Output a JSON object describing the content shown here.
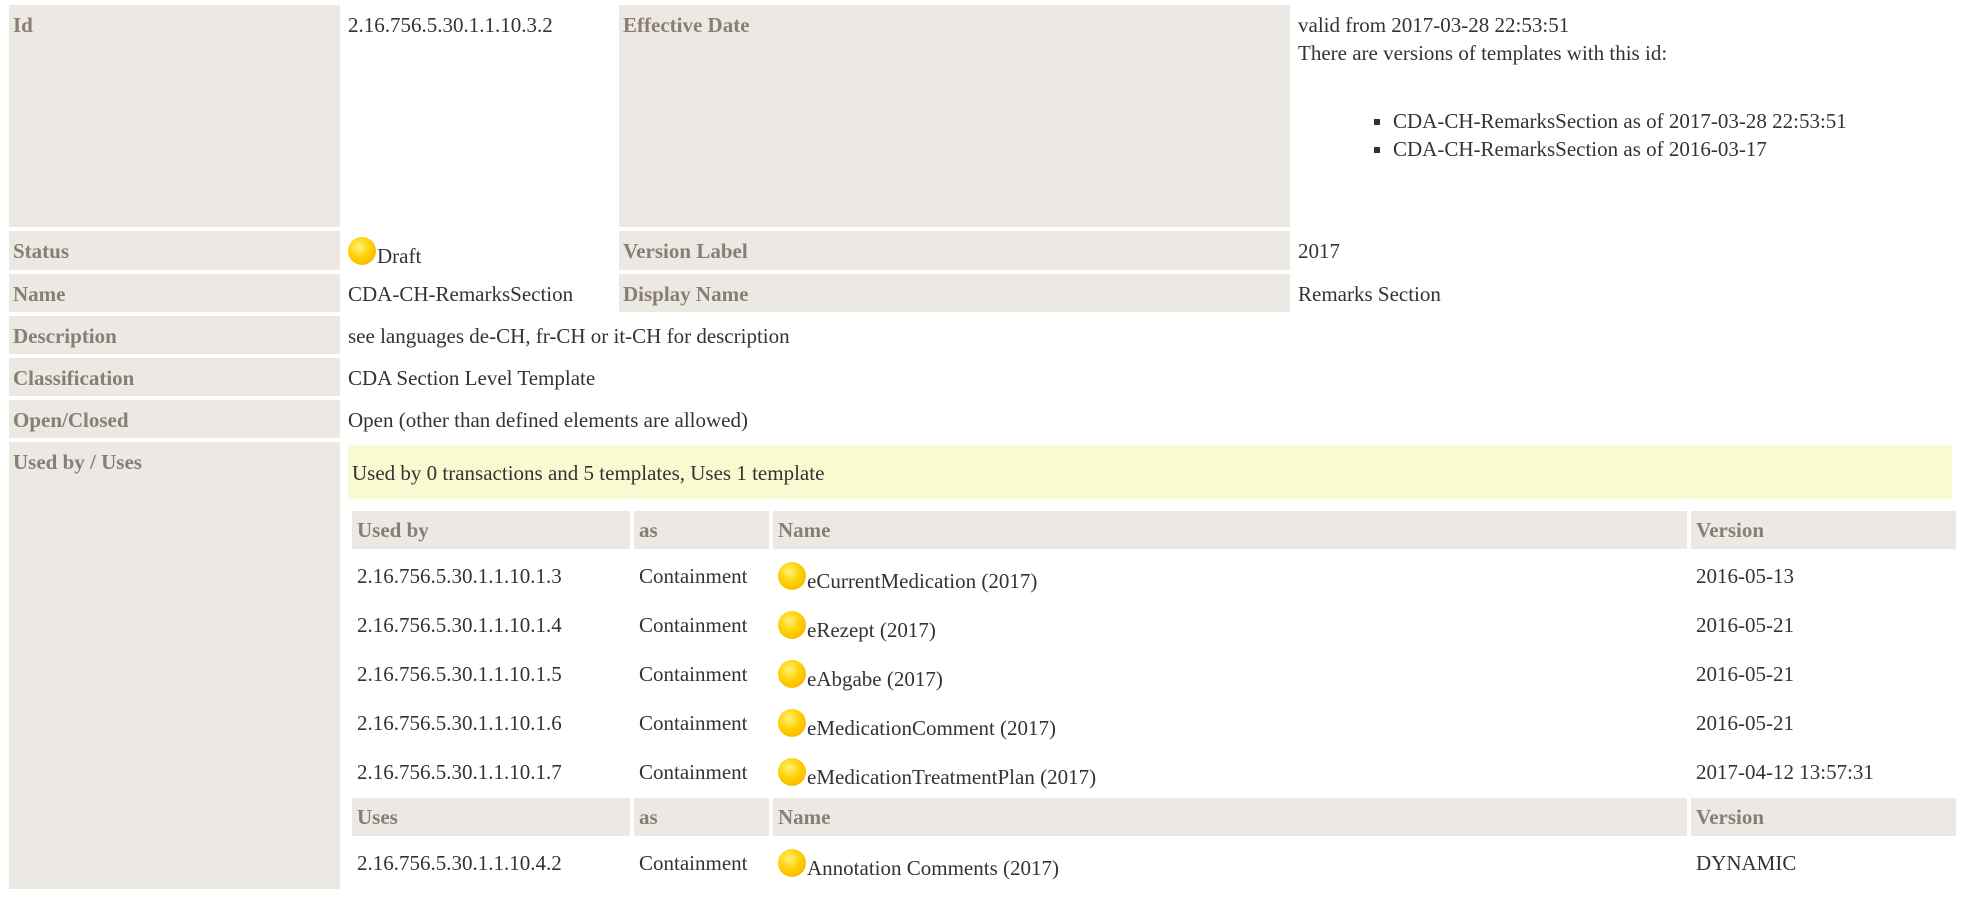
{
  "id": {
    "label": "Id",
    "value": "2.16.756.5.30.1.1.10.3.2"
  },
  "effective": {
    "label": "Effective Date",
    "valid_from": "valid from 2017-03-28 22:53:51",
    "versions_note": "There are versions of templates with this id:",
    "versions": [
      "CDA-CH-RemarksSection as of 2017-03-28 22:53:51",
      "CDA-CH-RemarksSection as of 2016-03-17"
    ]
  },
  "status": {
    "label": "Status",
    "value": "Draft",
    "icon": "sun-status-icon",
    "icon_color": "#ffd000"
  },
  "version_label": {
    "label": "Version Label",
    "value": "2017"
  },
  "name": {
    "label": "Name",
    "value": "CDA-CH-RemarksSection"
  },
  "display_name": {
    "label": "Display Name",
    "value": "Remarks Section"
  },
  "description": {
    "label": "Description",
    "value": "see languages de-CH, fr-CH or it-CH for description"
  },
  "classification": {
    "label": "Classification",
    "value": "CDA Section Level Template"
  },
  "open_closed": {
    "label": "Open/Closed",
    "value": "Open (other than defined elements are allowed)"
  },
  "used_by_uses": {
    "label": "Used by / Uses",
    "summary": "Used by 0 transactions and 5 templates, Uses 1 template",
    "used_by_headers": [
      "Used by",
      "as",
      "Name",
      "Version"
    ],
    "used_by_rows": [
      {
        "id": "2.16.756.5.30.1.1.10.1.3",
        "as": "Containment",
        "name": "eCurrentMedication (2017)",
        "version": "2016-05-13"
      },
      {
        "id": "2.16.756.5.30.1.1.10.1.4",
        "as": "Containment",
        "name": "eRezept (2017)",
        "version": "2016-05-21"
      },
      {
        "id": "2.16.756.5.30.1.1.10.1.5",
        "as": "Containment",
        "name": "eAbgabe (2017)",
        "version": "2016-05-21"
      },
      {
        "id": "2.16.756.5.30.1.1.10.1.6",
        "as": "Containment",
        "name": "eMedicationComment (2017)",
        "version": "2016-05-21"
      },
      {
        "id": "2.16.756.5.30.1.1.10.1.7",
        "as": "Containment",
        "name": "eMedicationTreatmentPlan (2017)",
        "version": "2017-04-12 13:57:31"
      }
    ],
    "uses_headers": [
      "Uses",
      "as",
      "Name",
      "Version"
    ],
    "uses_rows": [
      {
        "id": "2.16.756.5.30.1.1.10.4.2",
        "as": "Containment",
        "name": "Annotation Comments (2017)",
        "version": "DYNAMIC"
      }
    ]
  }
}
